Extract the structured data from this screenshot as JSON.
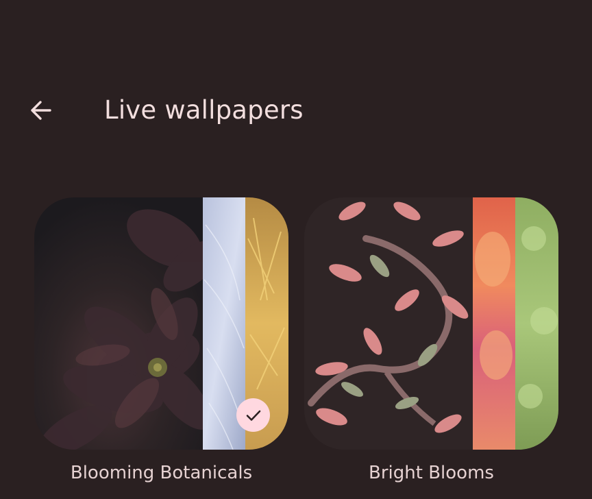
{
  "header": {
    "back_icon": "arrow-back-icon",
    "title": "Live wallpapers"
  },
  "wallpapers": [
    {
      "label": "Blooming Botanicals",
      "selected": true
    },
    {
      "label": "Bright Blooms",
      "selected": false
    }
  ],
  "selected_icon": "check-icon",
  "colors": {
    "background": "#2a2021",
    "title_text": "#f2dede",
    "label_text": "#e6d2d2",
    "badge": "#ffd8e0"
  }
}
